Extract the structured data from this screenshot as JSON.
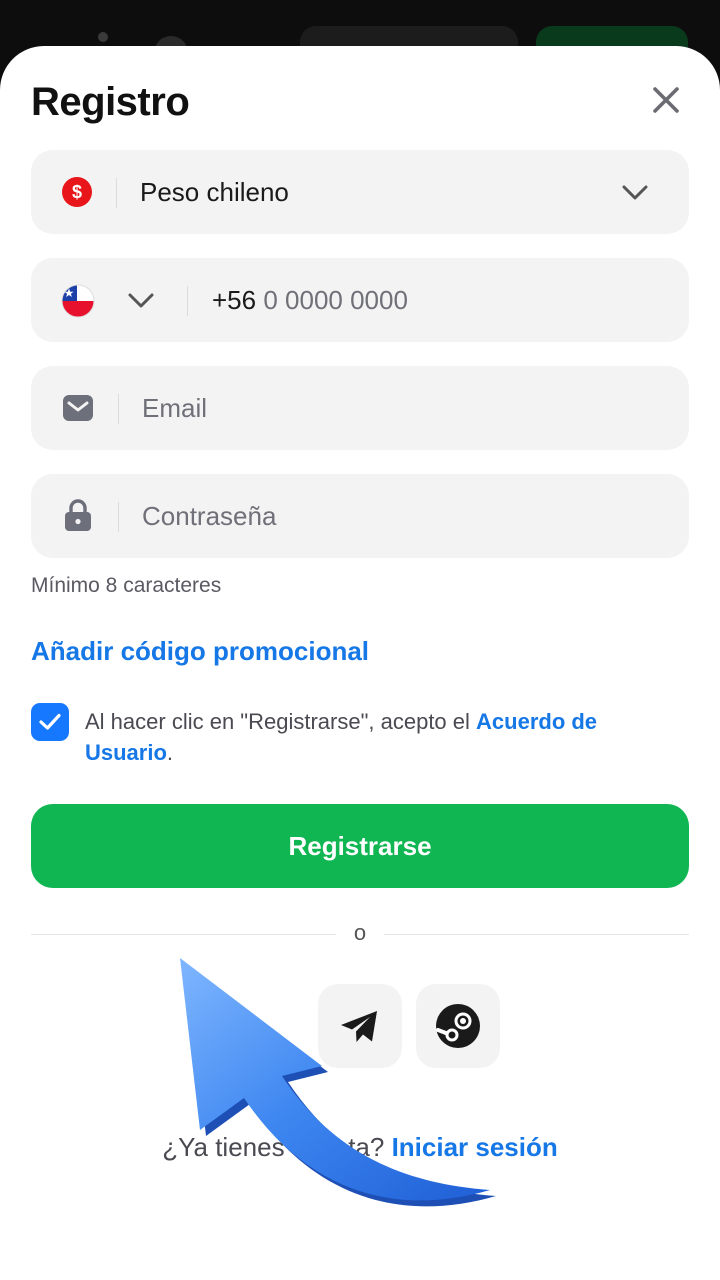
{
  "title": "Registro",
  "currency": {
    "value": "Peso chileno",
    "icon": "dollar-coin-icon"
  },
  "phone": {
    "code": "+56",
    "placeholder": "0 0000 0000",
    "flag": "chile-flag-icon"
  },
  "email": {
    "placeholder": "Email"
  },
  "password": {
    "placeholder": "Contraseña",
    "hint": "Mínimo 8 caracteres"
  },
  "promo_label": "Añadir código promocional",
  "agreement": {
    "checked": true,
    "text": "Al hacer clic en \"Registrarse\", acepto el ",
    "link": "Acuerdo de Usuario",
    "suffix": "."
  },
  "register_label": "Registrarse",
  "or_label": "o",
  "social": [
    "telegram-icon",
    "steam-icon"
  ],
  "login": {
    "text": "¿Ya tienes cuenta? ",
    "link": "Iniciar sesión"
  },
  "colors": {
    "primary": "#0fb651",
    "link": "#1677e6",
    "checkbox": "#1677ff",
    "field_bg": "#f3f3f4"
  }
}
